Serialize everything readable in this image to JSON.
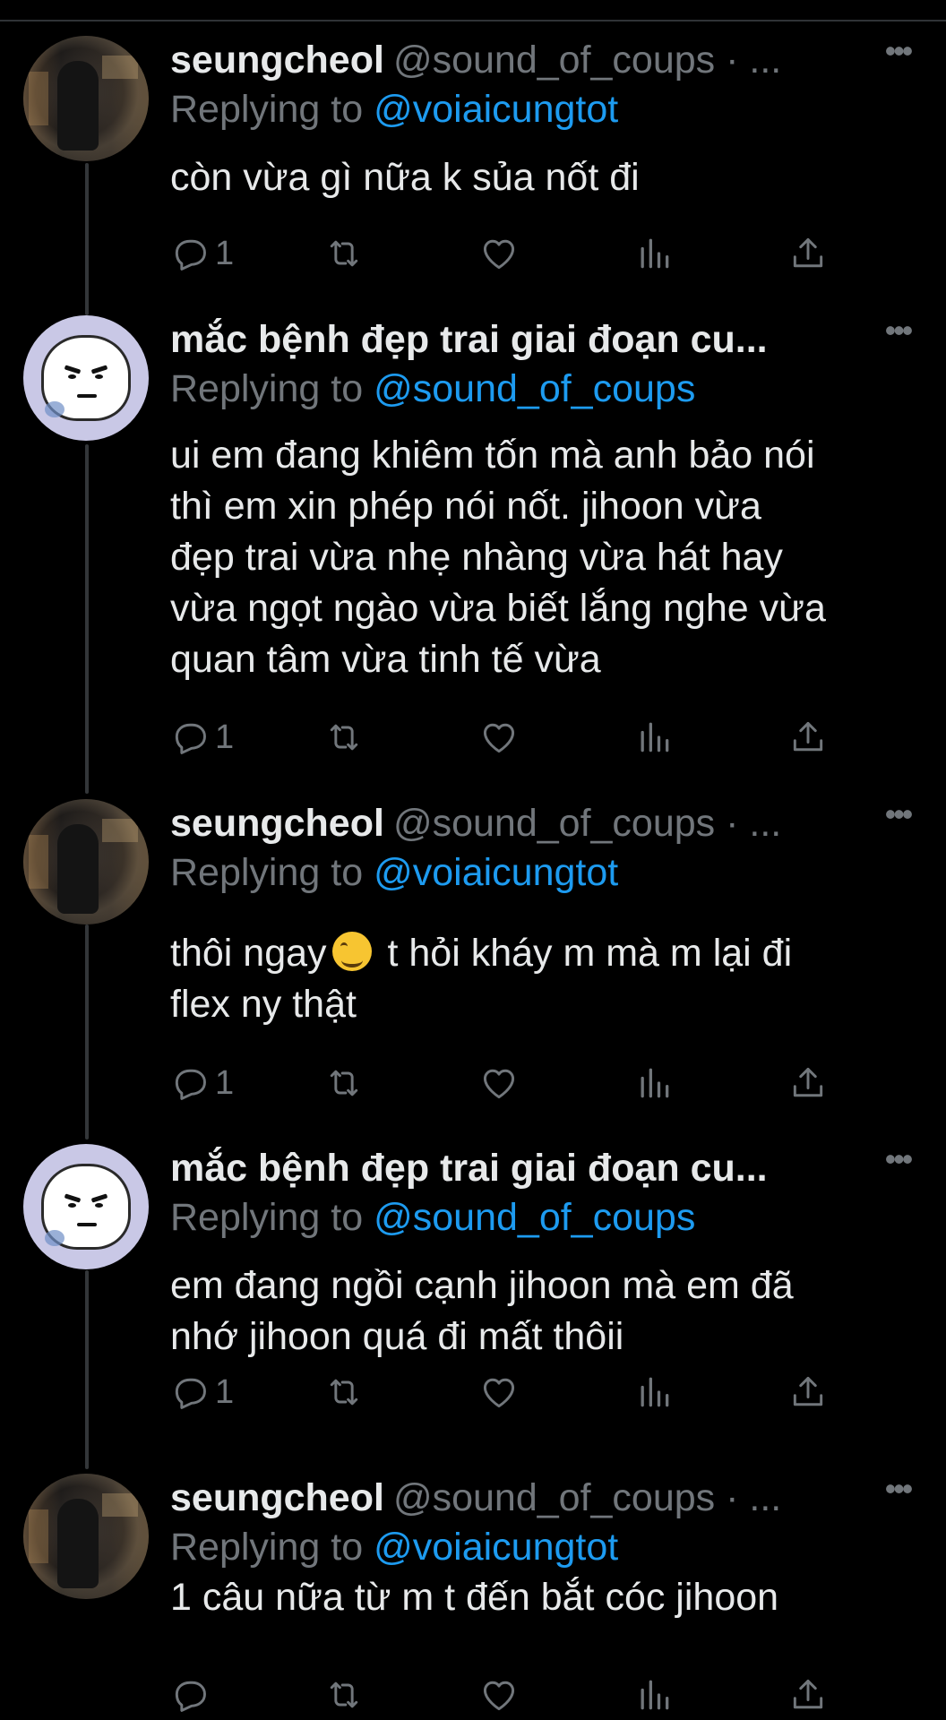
{
  "tweets": [
    {
      "name": "seungcheol",
      "handle": "@sound_of_coups · ...",
      "reply_prefix": "Replying to",
      "reply_to": "@voiaicungtot",
      "avatar": "photo-avatar",
      "lines": [
        "còn vừa gì nữa k sủa nốt đi"
      ],
      "reply_count": "1"
    },
    {
      "name": "mắc bệnh đẹp trai giai đoạn cu...",
      "handle": "",
      "reply_prefix": "Replying to",
      "reply_to": "@sound_of_coups",
      "avatar": "cartoon-avatar",
      "lines": [
        "ui em đang khiêm tốn mà anh bảo nói",
        "thì em xin phép nói nốt. jihoon vừa",
        "đẹp trai vừa nhẹ nhàng vừa hát hay",
        "vừa ngọt ngào vừa biết lắng nghe vừa",
        "quan tâm vừa tinh tế vừa"
      ],
      "reply_count": "1"
    },
    {
      "name": "seungcheol",
      "handle": "@sound_of_coups · ...",
      "reply_prefix": "Replying to",
      "reply_to": "@voiaicungtot",
      "avatar": "photo-avatar",
      "line1_before_emoji": "thôi ngay",
      "line1_after_emoji": " t hỏi kháy m mà m lại đi",
      "line2": "flex ny thật",
      "emoji": "grinning-sweat-emoji",
      "reply_count": "1"
    },
    {
      "name": "mắc bệnh đẹp trai giai đoạn cu...",
      "handle": "",
      "reply_prefix": "Replying to",
      "reply_to": "@sound_of_coups",
      "avatar": "cartoon-avatar",
      "lines": [
        "em đang ngồi cạnh jihoon mà em đã",
        "nhớ jihoon quá đi mất thôii"
      ],
      "reply_count": "1"
    },
    {
      "name": "seungcheol",
      "handle": "@sound_of_coups · ...",
      "reply_prefix": "Replying to",
      "reply_to": "@voiaicungtot",
      "avatar": "photo-avatar",
      "lines": [
        "1 câu nữa từ m t đến bắt cóc jihoon"
      ],
      "reply_count": ""
    }
  ],
  "colors": {
    "background": "#000000",
    "text": "#e7e9ea",
    "muted": "#71767b",
    "link": "#1d9bf0",
    "thread_line": "#333639"
  },
  "icons": [
    "reply-icon",
    "retweet-icon",
    "like-icon",
    "views-icon",
    "share-icon",
    "more-icon"
  ]
}
